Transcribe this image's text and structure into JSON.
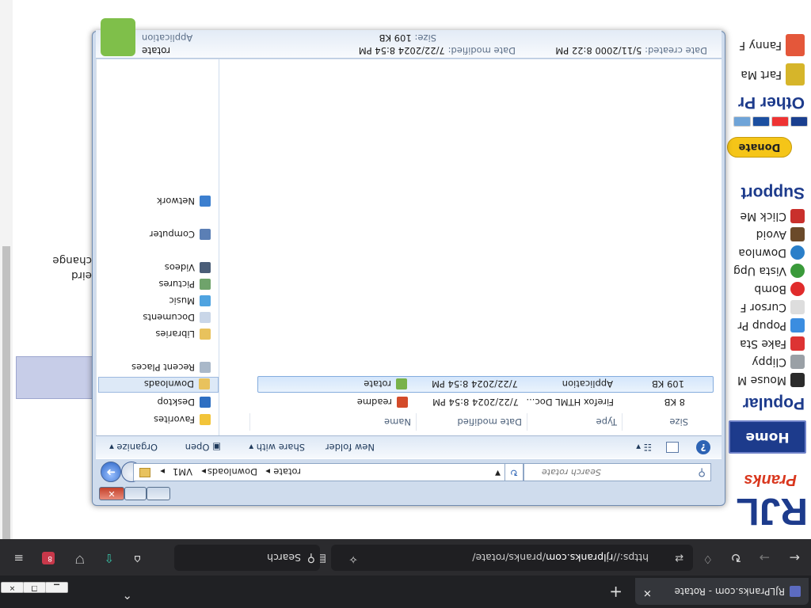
{
  "browser": {
    "tab_title": "RJLPranks.com - Rotate",
    "url_prefix": "https://",
    "url_domain": "rjlpranks.com",
    "url_path": "/pranks/rotate/",
    "search_label": "Search",
    "profile_badge": "8"
  },
  "site": {
    "logo_text": "RJL",
    "logo_sub": "Pranks",
    "home_label": "Home",
    "popular_heading": "Popular",
    "popular_items": [
      "Mouse M",
      "Clippy",
      "Fake Sta",
      "Popup Pr",
      "Cursor F",
      "Bomb",
      "Vista Upg",
      "Downloa",
      "Avoid",
      "Click Me"
    ],
    "support_heading": "Support",
    "donate_label": "Donate",
    "other_heading": "Other Pr",
    "other_items": [
      "Fart Ma",
      "Fanny F"
    ],
    "body_text_1": "eird",
    "body_text_2": "change"
  },
  "explorer": {
    "breadcrumb": [
      "VM1",
      "Downloads",
      "rotate"
    ],
    "search_placeholder": "Search rotate",
    "toolbar": {
      "organize": "Organize",
      "open": "Open",
      "share_with": "Share with",
      "new_folder": "New folder"
    },
    "nav": {
      "favorites": "Favorites",
      "desktop": "Desktop",
      "downloads": "Downloads",
      "recent": "Recent Places",
      "libraries": "Libraries",
      "documents": "Documents",
      "music": "Music",
      "pictures": "Pictures",
      "videos": "Videos",
      "computer": "Computer",
      "network": "Network"
    },
    "columns": {
      "name": "Name",
      "date": "Date modified",
      "type": "Type",
      "size": "Size"
    },
    "files": [
      {
        "name": "readme",
        "date": "7/22/2024 8:54 PM",
        "type": "Firefox HTML Doc...",
        "size": "8 KB"
      },
      {
        "name": "rotate",
        "date": "7/22/2024 8:54 PM",
        "type": "Application",
        "size": "109 KB"
      }
    ],
    "details": {
      "name": "rotate",
      "type": "Application",
      "modified_label": "Date modified:",
      "modified": "7/22/2024 8:54 PM",
      "size_label": "Size:",
      "size": "109 KB",
      "created_label": "Date created:",
      "created": "5/11/2000 8:22 PM"
    }
  }
}
